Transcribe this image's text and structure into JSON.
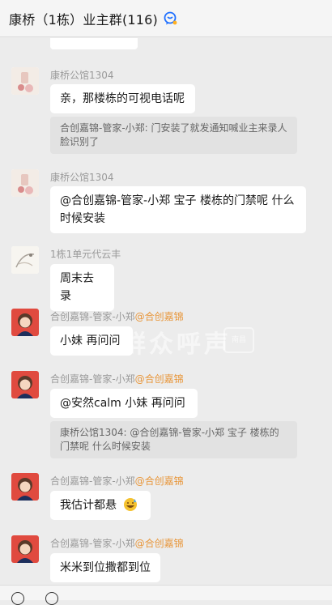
{
  "header": {
    "title": "康桥（1栋）业主群(116)",
    "icon": "chat-bubble-icon",
    "accent": "#1e6fff"
  },
  "messages": [
    {
      "sender": "康桥公馆1304",
      "sender_mention": "",
      "text": "亲，那楼栋的可视电话呢",
      "quote": "合创嘉锦-管家-小郑: 门安装了就发通知喊业主来录人脸识别了"
    },
    {
      "sender": "康桥公馆1304",
      "sender_mention": "",
      "text": "@合创嘉锦-管家-小郑 宝子 楼栋的门禁呢 什么时候安装",
      "quote": ""
    },
    {
      "sender": "1栋1单元代云丰",
      "sender_mention": "",
      "text": "周末去录",
      "quote": ""
    },
    {
      "sender": "合创嘉锦-管家-小郑",
      "sender_mention": "@合创嘉锦",
      "text": "小妹  再问问",
      "quote": ""
    },
    {
      "sender": "合创嘉锦-管家-小郑",
      "sender_mention": "@合创嘉锦",
      "text": "@安然calm 小妹  再问问",
      "quote": "康桥公馆1304: @合创嘉锦-管家-小郑 宝子 楼栋的门禁呢 什么时候安装"
    },
    {
      "sender": "合创嘉锦-管家-小郑",
      "sender_mention": "@合创嘉锦",
      "text": "我估计都悬",
      "emoji": "sweat-smile-emoji",
      "quote": ""
    },
    {
      "sender": "合创嘉锦-管家-小郑",
      "sender_mention": "@合创嘉锦",
      "text": "米米到位撒都到位",
      "quote": ""
    }
  ],
  "watermark": {
    "text": "群众呼声",
    "seal": "南昌"
  },
  "colors": {
    "background": "#ececec",
    "bubble": "#ffffff",
    "quote": "#e2e2e2",
    "mention": "#e8963a"
  }
}
